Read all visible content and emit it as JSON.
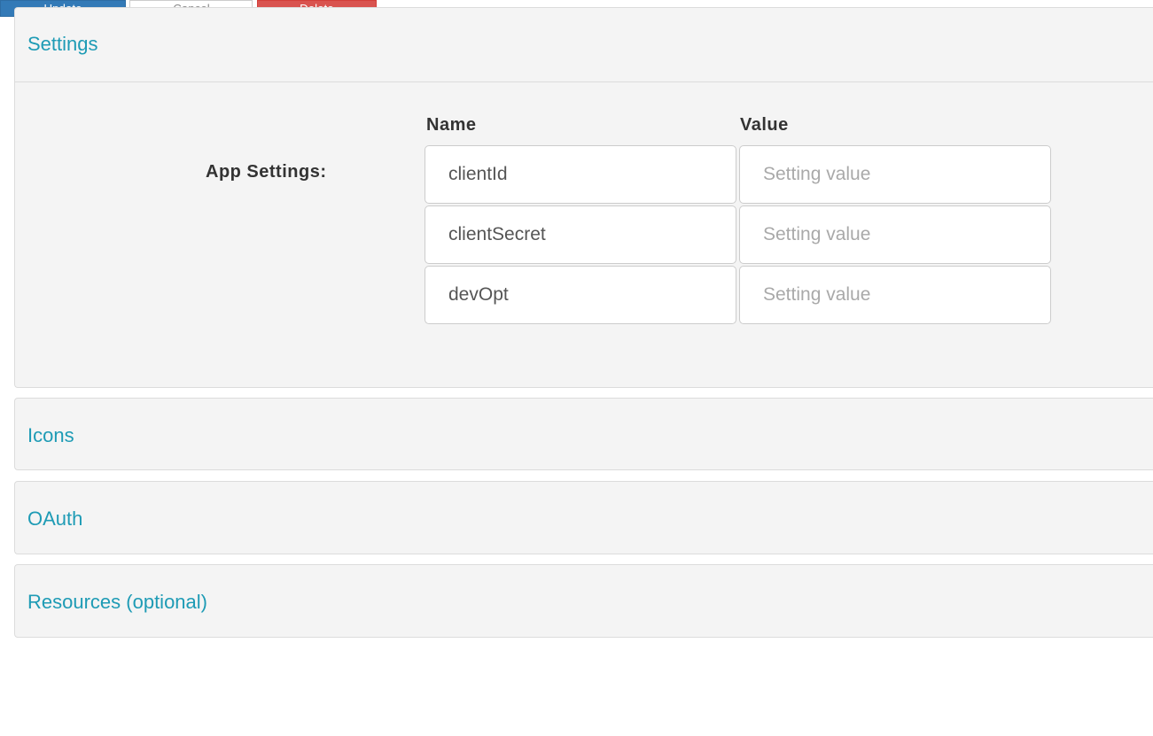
{
  "panels": {
    "settings": {
      "title": "Settings"
    },
    "icons": {
      "title": "Icons"
    },
    "oauth": {
      "title": "OAuth"
    },
    "resources": {
      "title": "Resources (optional)"
    }
  },
  "app_settings": {
    "label": "App Settings:",
    "name_header": "Name",
    "value_header": "Value",
    "rows": [
      {
        "name": "clientId",
        "value": "",
        "value_placeholder": "Setting value"
      },
      {
        "name": "clientSecret",
        "value": "",
        "value_placeholder": "Setting value"
      },
      {
        "name": "devOpt",
        "value": "",
        "value_placeholder": "Setting value"
      }
    ]
  },
  "actions": {
    "update_label": "Update",
    "cancel_label": "Cancel",
    "delete_label": "Delete"
  },
  "colors": {
    "panel_link": "#1e9bb5",
    "primary": "#337ab7",
    "danger": "#d9534f"
  }
}
